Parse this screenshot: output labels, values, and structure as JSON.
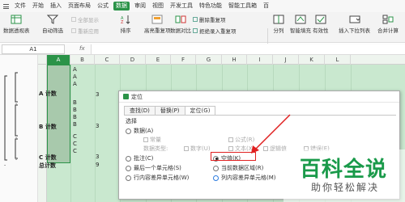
{
  "menubar": {
    "items": [
      "文件",
      "开始",
      "插入",
      "页面布局",
      "公式",
      "数据",
      "审阅",
      "视图",
      "开发工具",
      "特色功能",
      "智能工具箱",
      "百"
    ],
    "active_index": 5
  },
  "ribbon": {
    "buttons": [
      "数据透视表",
      "自动筛选",
      "全部显示",
      "重新应用",
      "排序",
      "高亮重复项",
      "删除重复项",
      "拒绝录入重复项",
      "数据对比",
      "分列",
      "智能填充",
      "有效性",
      "插入下拉列表",
      "合并计算"
    ]
  },
  "formula_bar": {
    "cell_ref": "A1",
    "fx": "fx"
  },
  "columns": [
    "A",
    "B",
    "C",
    "D",
    "E",
    "F",
    "G",
    "H",
    "I",
    "J",
    "K",
    "L"
  ],
  "sheet": {
    "col_b_letters": [
      "A",
      "A",
      "A",
      "B",
      "B",
      "B",
      "B",
      "C",
      "C",
      "C"
    ],
    "group_labels": [
      "A 计数",
      "B 计数",
      "C 计数",
      "总计数"
    ],
    "counts": [
      "3",
      "3",
      "3",
      "9"
    ]
  },
  "dialog": {
    "title": "定位",
    "tabs": [
      "查找(D)",
      "替换(P)",
      "定位(G)"
    ],
    "active_tab": 2,
    "section": "选择",
    "options": {
      "data": "数据(A)",
      "constant": "常量",
      "formula": "公式(R)",
      "data_type": "数据类型:",
      "number": "数字(U)",
      "text": "文本(X)",
      "logical": "逻辑值",
      "error": "错误(E)",
      "comments": "批注(C)",
      "blank": "空值(K)",
      "last_cell": "最后一个单元格(S)",
      "current_region": "当前数据区域(R)",
      "row_diff": "行内容差异单元格(W)",
      "col_diff": "列内容差异单元格(M)"
    }
  },
  "watermark": {
    "big": "百科全说",
    "small": "助你轻松解决"
  },
  "colors": {
    "accent": "#2b9348",
    "highlight": "#e02020",
    "grid_bg": "#c9e8cf"
  }
}
